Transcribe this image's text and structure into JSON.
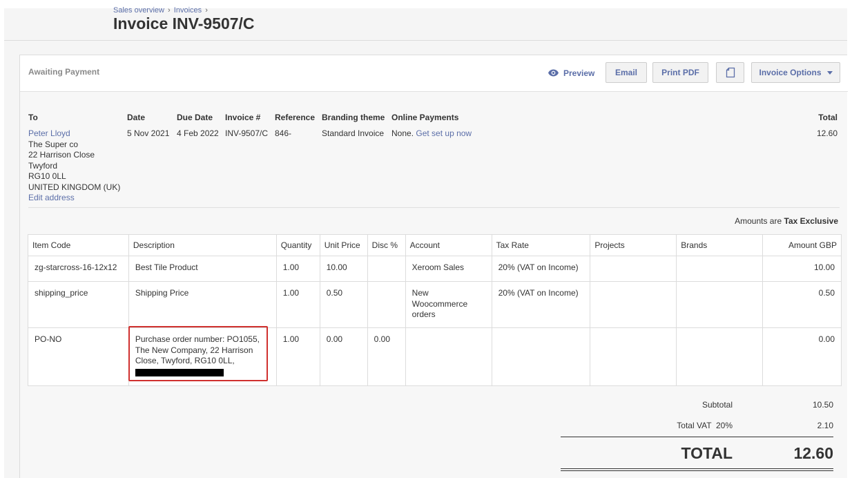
{
  "breadcrumb": {
    "items": [
      "Sales overview",
      "Invoices"
    ],
    "separator": "›"
  },
  "page_title": "Invoice INV-9507/C",
  "status": "Awaiting Payment",
  "toolbar": {
    "preview_label": "Preview",
    "preview_icon": "eye-icon",
    "email_label": "Email",
    "print_pdf_label": "Print PDF",
    "copy_icon": "copy-icon",
    "invoice_options_label": "Invoice Options"
  },
  "info": {
    "headers": {
      "to": "To",
      "date": "Date",
      "due_date": "Due Date",
      "invoice_no": "Invoice #",
      "reference": "Reference",
      "branding": "Branding theme",
      "online_payments": "Online Payments",
      "total": "Total"
    },
    "contact_name": "Peter Lloyd",
    "address_lines": [
      "The Super co",
      "22 Harrison Close",
      "Twyford",
      "RG10 0LL",
      "UNITED KINGDOM (UK)"
    ],
    "edit_address": "Edit address",
    "date": "5 Nov 2021",
    "due_date": "4 Feb 2022",
    "invoice_no": "INV-9507/C",
    "reference": "846-",
    "branding": "Standard Invoice",
    "online_payments_prefix": "None.",
    "online_payments_link": "Get set up now",
    "total": "12.60"
  },
  "amounts_prefix": "Amounts are",
  "amounts_mode": "Tax Exclusive",
  "table": {
    "columns": [
      "Item Code",
      "Description",
      "Quantity",
      "Unit Price",
      "Disc %",
      "Account",
      "Tax Rate",
      "Projects",
      "Brands",
      "Amount GBP"
    ],
    "rows": [
      {
        "code": "zg-starcross-16-12x12",
        "desc": "Best Tile Product",
        "qty": "1.00",
        "price": "10.00",
        "disc": "",
        "account": "Xeroom Sales",
        "tax": "20% (VAT on Income)",
        "projects": "",
        "brands": "",
        "amount": "10.00"
      },
      {
        "code": "shipping_price",
        "desc": "Shipping Price",
        "qty": "1.00",
        "price": "0.50",
        "disc": "",
        "account": "New Woocommerce orders",
        "tax": "20% (VAT on Income)",
        "projects": "",
        "brands": "",
        "amount": "0.50"
      },
      {
        "code": "PO-NO",
        "desc": "Purchase order number: PO1055, The New Company, 22 Harrison Close, Twyford, RG10 0LL,",
        "qty": "1.00",
        "price": "0.00",
        "disc": "0.00",
        "account": "",
        "tax": "",
        "projects": "",
        "brands": "",
        "amount": "0.00"
      }
    ]
  },
  "totals": {
    "subtotal_label": "Subtotal",
    "subtotal": "10.50",
    "vat_label": "Total VAT  20%",
    "vat": "2.10",
    "total_label": "TOTAL",
    "total": "12.60"
  },
  "colors": {
    "link": "#5b6ea8",
    "highlight": "#d0302e"
  }
}
